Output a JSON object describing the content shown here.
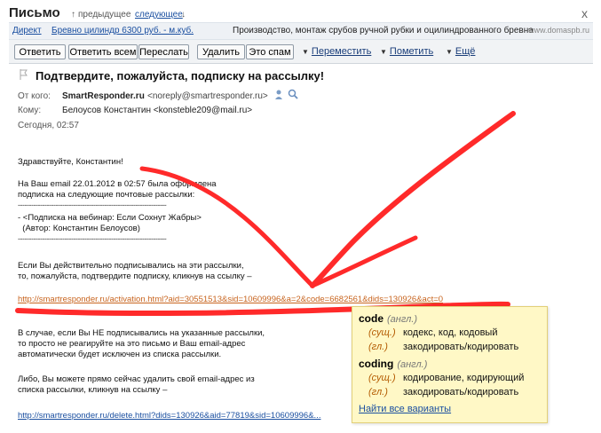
{
  "header": {
    "title": "Письмо",
    "prev_label": "предыдущее",
    "next_label": "следующее",
    "close": "x"
  },
  "ad": {
    "label": "Директ",
    "link": "Бревно цилиндр 6300 руб. - м.куб.",
    "text": "Производство, монтаж срубов ручной рубки и оцилиндрованного бревна",
    "domain": "www.domaspb.ru"
  },
  "toolbar": {
    "reply": "Ответить",
    "reply_all": "Ответить всем",
    "forward": "Переслать",
    "delete": "Удалить",
    "spam": "Это спам",
    "move": "Переместить",
    "mark": "Пометить",
    "more": "Ещё"
  },
  "message": {
    "subject": "Подтвердите, пожалуйста, подписку на рассылку!",
    "from_label": "От кого:",
    "from_name": "SmartResponder.ru",
    "from_email": "<noreply@smartresponder.ru>",
    "to_label": "Кому:",
    "to_value": "Белоусов Константин <konsteble209@mail.ru>",
    "date": "Сегодня, 02:57"
  },
  "body": {
    "greeting": "Здравствуйте, Константин!",
    "p1_line1": "На Ваш email 22.01.2012 в 02:57 была оформлена",
    "p1_line2": "подписка на следующие почтовые рассылки:",
    "separator": "-------------------------------------------------------------------",
    "sub_line1": "- <Подписка на вебинар: Если Сохнут Жабры>",
    "sub_line2": "  (Автор: Константин Белоусов)",
    "p2_line1": "Если Вы действительно подписывались на эти рассылки,",
    "p2_line2": "то, пожалуйста, подтвердите подписку, кликнув на ссылку –",
    "activation_link": "http://smartresponder.ru/activation.html?aid=30551513&sid=10609996&a=2&code=6682561&dids=130926&act=0",
    "p3_line1": "В случае, если Вы НЕ подписывались на указанные рассылки,",
    "p3_line2": "то просто не реагируйте на это письмо и Ваш email-адрес",
    "p3_line3": "автоматически будет исключен из списка рассылки.",
    "p4_line1": "Либо, Вы можете прямо сейчас удалить свой email-адрес из",
    "p4_line2": "списка рассылки, кликнув на ссылку –",
    "delete_link": "http://smartresponder.ru/delete.html?dids=130926&aid=77819&sid=10609996&..."
  },
  "dictionary_popup": {
    "word1": "code",
    "word1_lang": "(англ.)",
    "w1_pos1": "(сущ.)",
    "w1_tr1": "кодекс, код, кодовый",
    "w1_pos2": "(гл.)",
    "w1_tr2": "закодировать/кодировать",
    "word2": "coding",
    "word2_lang": "(англ.)",
    "w2_pos1": "(сущ.)",
    "w2_tr1": "кодирование, кодирующий",
    "w2_pos2": "(гл.)",
    "w2_tr2": "закодировать/кодировать",
    "find_all": "Найти все варианты"
  },
  "colors": {
    "annotation": "#ff2a2a",
    "link": "#1a4fa0",
    "activation_link": "#c8641e",
    "popup_bg": "#fff8c6"
  }
}
